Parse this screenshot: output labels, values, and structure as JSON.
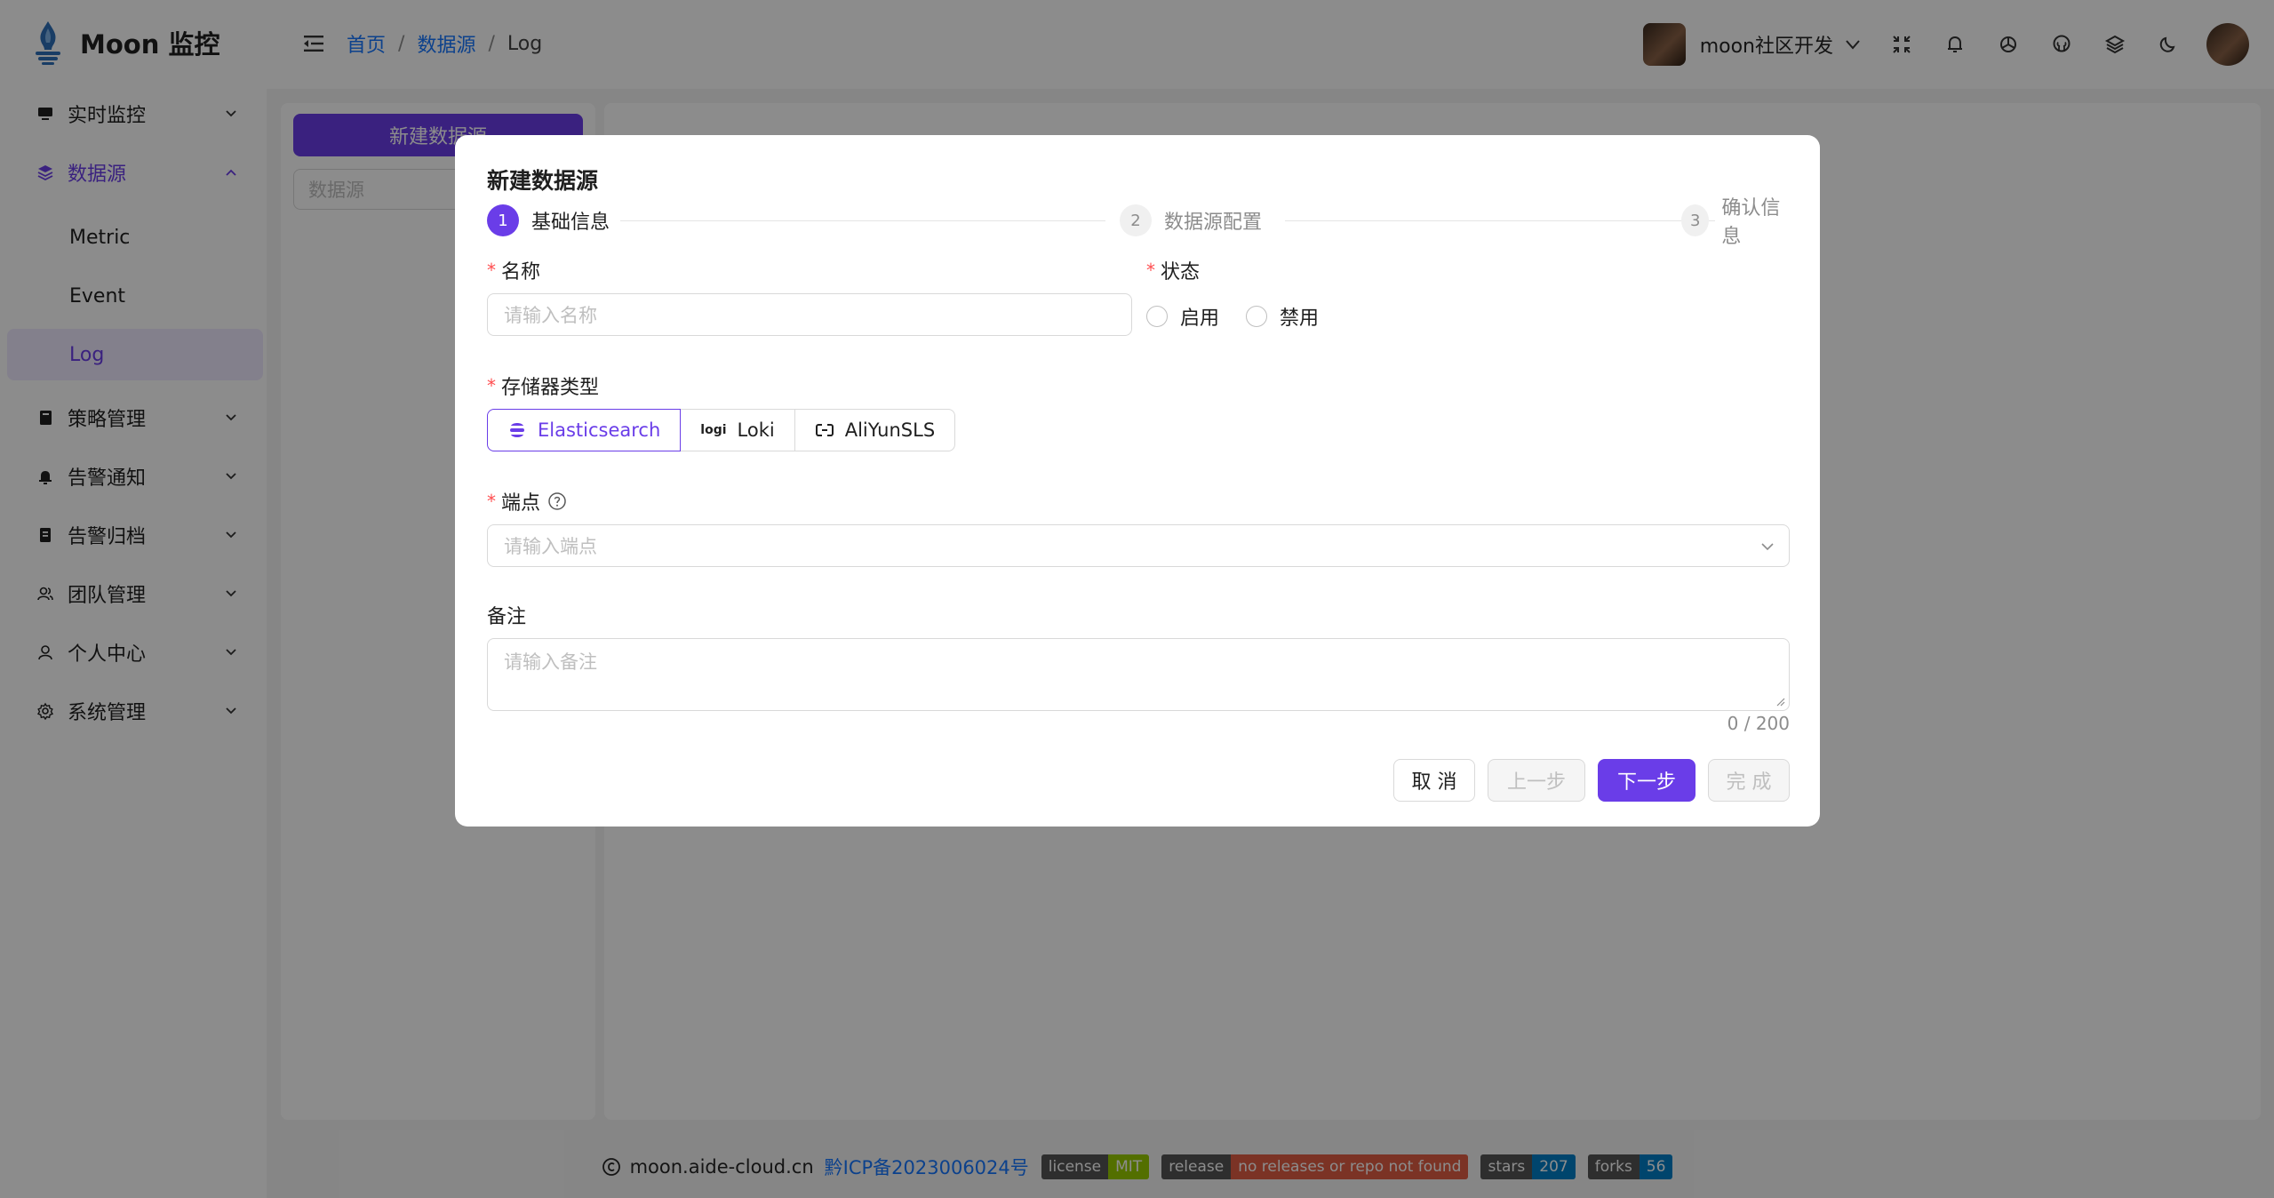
{
  "app": {
    "title": "Moon 监控"
  },
  "header": {
    "breadcrumb": [
      "首页",
      "数据源",
      "Log"
    ],
    "user_name": "moon社区开发",
    "icons": [
      "fullscreen-icon",
      "bell-icon",
      "openai-icon",
      "github-icon",
      "layers-icon",
      "moon-icon"
    ]
  },
  "sidebar": {
    "items": [
      {
        "label": "实时监控",
        "icon": "monitor-icon"
      },
      {
        "label": "数据源",
        "icon": "layers-icon",
        "open": true
      },
      {
        "label": "Metric"
      },
      {
        "label": "Event"
      },
      {
        "label": "Log",
        "active": true
      },
      {
        "label": "策略管理",
        "icon": "book-icon"
      },
      {
        "label": "告警通知",
        "icon": "bell-icon"
      },
      {
        "label": "告警归档",
        "icon": "archive-icon"
      },
      {
        "label": "团队管理",
        "icon": "team-icon"
      },
      {
        "label": "个人中心",
        "icon": "user-icon"
      },
      {
        "label": "系统管理",
        "icon": "gear-icon"
      }
    ]
  },
  "content": {
    "new_button": "新建数据源",
    "search_placeholder": "数据源"
  },
  "modal": {
    "title": "新建数据源",
    "steps": [
      {
        "num": "1",
        "label": "基础信息",
        "status": "active"
      },
      {
        "num": "2",
        "label": "数据源配置",
        "status": "wait"
      },
      {
        "num": "3",
        "label": "确认信息",
        "status": "wait"
      }
    ],
    "name": {
      "label": "名称",
      "placeholder": "请输入名称"
    },
    "status": {
      "label": "状态",
      "options": [
        "启用",
        "禁用"
      ]
    },
    "storage": {
      "label": "存储器类型",
      "options": [
        "Elasticsearch",
        "Loki",
        "AliYunSLS"
      ],
      "selected": "Elasticsearch",
      "loki_mark": "logi"
    },
    "endpoint": {
      "label": "端点",
      "placeholder": "请输入端点"
    },
    "remark": {
      "label": "备注",
      "placeholder": "请输入备注",
      "counter": "0 / 200"
    },
    "buttons": {
      "cancel": "取 消",
      "prev": "上一步",
      "next": "下一步",
      "finish": "完 成"
    }
  },
  "footer": {
    "site": "moon.aide-cloud.cn",
    "icp": "黔ICP备2023006024号",
    "badges": [
      {
        "label": "license",
        "value": "MIT",
        "color": "#97ca00"
      },
      {
        "label": "release",
        "value": "no releases or repo not found",
        "color": "#e05d44"
      },
      {
        "label": "stars",
        "value": "207",
        "color": "#007ec6"
      },
      {
        "label": "forks",
        "value": "56",
        "color": "#007ec6"
      }
    ]
  },
  "colors": {
    "primary": "#6a3de8",
    "link": "#1677ff",
    "required": "#ff4d4f"
  }
}
